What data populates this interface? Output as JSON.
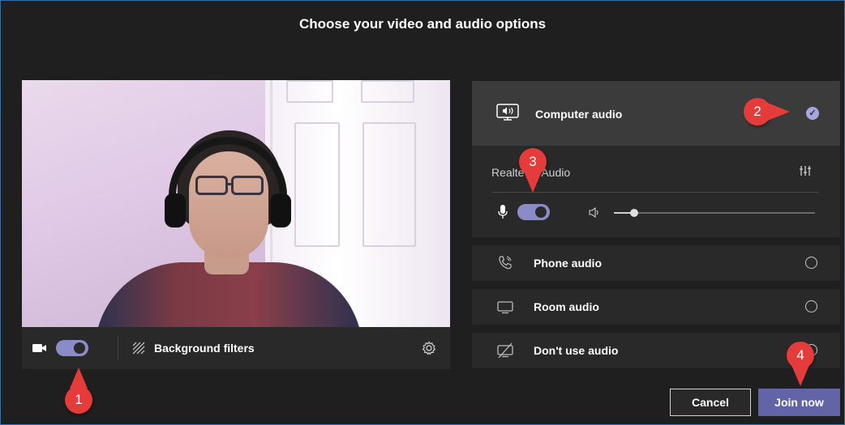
{
  "dialog": {
    "title": "Choose your video and audio options"
  },
  "video": {
    "camera_on": true,
    "background_filters_label": "Background filters"
  },
  "audio": {
    "computer_audio": {
      "label": "Computer audio",
      "selected": true
    },
    "device_name": "Realtek USB Audio",
    "device_name_visible": "Realte   B Audio",
    "mic_on": true,
    "speaker_volume_fraction": 0.1,
    "options": [
      {
        "label": "Phone audio",
        "icon": "phone-icon",
        "selected": false
      },
      {
        "label": "Room audio",
        "icon": "monitor-icon",
        "selected": false
      },
      {
        "label": "Don't use audio",
        "icon": "speaker-off-icon",
        "selected": false
      }
    ]
  },
  "buttons": {
    "cancel": "Cancel",
    "join": "Join now"
  },
  "callouts": [
    "1",
    "2",
    "3",
    "4"
  ],
  "colors": {
    "accent": "#6264a7",
    "toggle_on": "#8b8cc7",
    "callout": "#e63b3b",
    "background": "#1f1f1f"
  }
}
